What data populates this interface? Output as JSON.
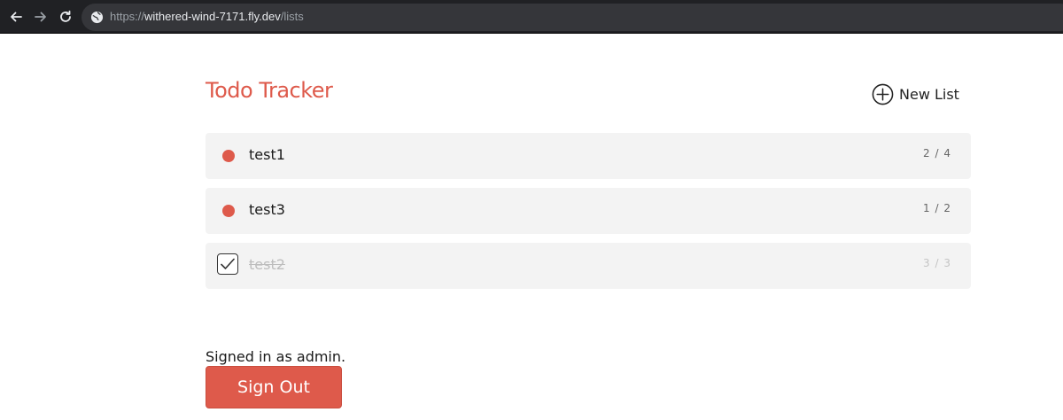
{
  "browser": {
    "url_prefix": "https://",
    "url_host": "withered-wind-7171.fly.dev",
    "url_path": "/lists",
    "icons": {
      "back": "arrow-left-icon",
      "forward": "arrow-right-icon",
      "reload": "reload-icon",
      "site": "globe-icon"
    }
  },
  "header": {
    "title": "Todo Tracker",
    "new_list_label": "New List"
  },
  "lists": [
    {
      "name": "test1",
      "count": "2 / 4",
      "completed": false
    },
    {
      "name": "test3",
      "count": "1 / 2",
      "completed": false
    },
    {
      "name": "test2",
      "count": "3 / 3",
      "completed": true
    }
  ],
  "footer": {
    "signed_in_text": "Signed in as admin.",
    "sign_out_label": "Sign Out"
  },
  "colors": {
    "accent": "#de5a4b",
    "item_bg": "#f3f3f3",
    "browser_bg": "#202124"
  }
}
